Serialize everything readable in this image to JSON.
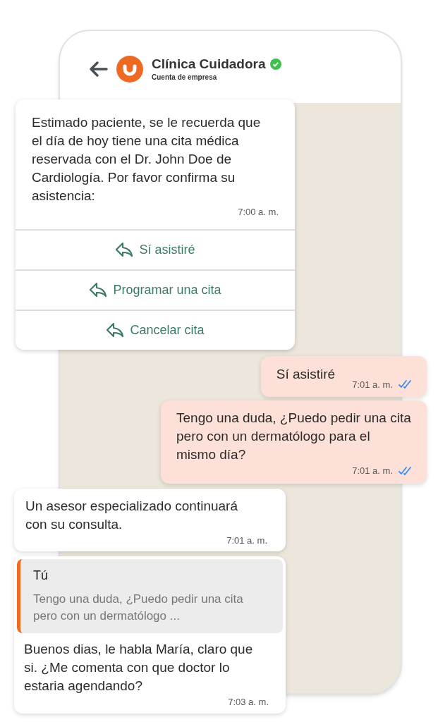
{
  "header": {
    "title": "Clínica Cuidadora",
    "subtitle": "Cuenta de empresa",
    "verified": true
  },
  "messages": [
    {
      "kind": "buttons",
      "text": "Estimado paciente, se le recuerda que el día de hoy tiene una cita médica reservada con el Dr. John Doe de Cardiología. Por favor confirma su asistencia:",
      "time": "7:00 a. m.",
      "buttons": [
        "Sí asistiré",
        "Programar una cita",
        "Cancelar cita"
      ]
    },
    {
      "kind": "sent",
      "text": "Sí asistiré",
      "time": "7:01 a. m.",
      "read": true
    },
    {
      "kind": "sent",
      "text": "Tengo una duda, ¿Puedo pedir una cita pero con un dermatólogo para el mismo día?",
      "time": "7:01 a. m.",
      "read": true
    },
    {
      "kind": "received",
      "text": "Un asesor especializado continuará con su consulta.",
      "time": "7:01 a. m."
    },
    {
      "kind": "reply",
      "quote_author": "Tú",
      "quote_text": "Tengo una duda, ¿Puedo pedir una cita pero con un dermatólogo ...",
      "text": "Buenos dias, le habla María, claro que si. ¿Me comenta con que doctor lo estaria agendando?",
      "time": "7:03 a. m."
    }
  ]
}
